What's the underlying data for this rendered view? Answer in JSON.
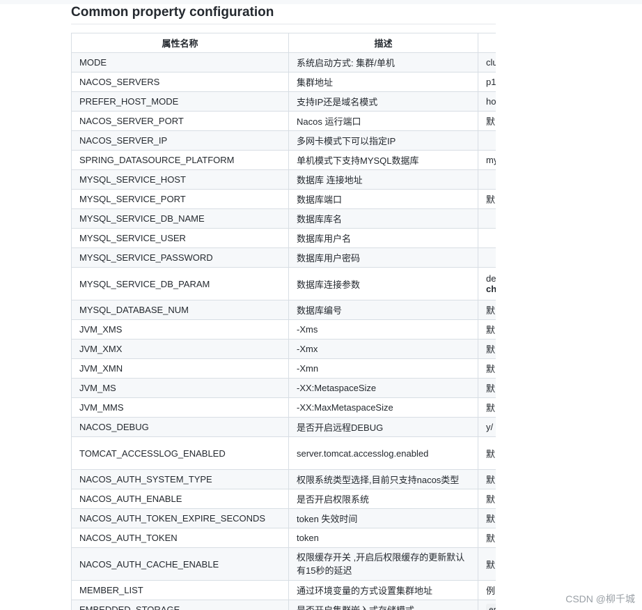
{
  "heading": "Common property configuration",
  "headers": [
    "属性名称",
    "描述",
    ""
  ],
  "rows": [
    {
      "name": "MODE",
      "desc": "系统启动方式: 集群/单机",
      "opt": "clu"
    },
    {
      "name": "NACOS_SERVERS",
      "desc": "集群地址",
      "opt": "p1"
    },
    {
      "name": "PREFER_HOST_MODE",
      "desc": "支持IP还是域名模式",
      "opt": "ho"
    },
    {
      "name": "NACOS_SERVER_PORT",
      "desc": "Nacos 运行端口",
      "opt": "默"
    },
    {
      "name": "NACOS_SERVER_IP",
      "desc": "多网卡模式下可以指定IP",
      "opt": ""
    },
    {
      "name": "SPRING_DATASOURCE_PLATFORM",
      "desc": "单机模式下支持MYSQL数据库",
      "opt": "my"
    },
    {
      "name": "MYSQL_SERVICE_HOST",
      "desc": "数据库 连接地址",
      "opt": ""
    },
    {
      "name": "MYSQL_SERVICE_PORT",
      "desc": "数据库端口",
      "opt": "默"
    },
    {
      "name": "MYSQL_SERVICE_DB_NAME",
      "desc": "数据库库名",
      "opt": ""
    },
    {
      "name": "MYSQL_SERVICE_USER",
      "desc": "数据库用户名",
      "opt": ""
    },
    {
      "name": "MYSQL_SERVICE_PASSWORD",
      "desc": "数据库用户密码",
      "opt": ""
    },
    {
      "name": "MYSQL_SERVICE_DB_PARAM",
      "desc": "数据库连接参数",
      "opt": "de",
      "opt2": "ch"
    },
    {
      "name": "MYSQL_DATABASE_NUM",
      "desc": "数据库编号",
      "opt": "默"
    },
    {
      "name": "JVM_XMS",
      "desc": "-Xms",
      "opt": "默"
    },
    {
      "name": "JVM_XMX",
      "desc": "-Xmx",
      "opt": "默"
    },
    {
      "name": "JVM_XMN",
      "desc": "-Xmn",
      "opt": "默"
    },
    {
      "name": "JVM_MS",
      "desc": "-XX:MetaspaceSize",
      "opt": "默"
    },
    {
      "name": "JVM_MMS",
      "desc": "-XX:MaxMetaspaceSize",
      "opt": "默"
    },
    {
      "name": "NACOS_DEBUG",
      "desc": "是否开启远程DEBUG",
      "opt": "y/"
    },
    {
      "name": "TOMCAT_ACCESSLOG_ENABLED",
      "desc": "server.tomcat.accesslog.enabled",
      "opt": "默"
    },
    {
      "name": "NACOS_AUTH_SYSTEM_TYPE",
      "desc": "权限系统类型选择,目前只支持nacos类型",
      "opt": "默"
    },
    {
      "name": "NACOS_AUTH_ENABLE",
      "desc": "是否开启权限系统",
      "opt": "默"
    },
    {
      "name": "NACOS_AUTH_TOKEN_EXPIRE_SECONDS",
      "desc": "token 失效时间",
      "opt": "默"
    },
    {
      "name": "NACOS_AUTH_TOKEN",
      "desc": "token",
      "opt": "默"
    },
    {
      "name": "NACOS_AUTH_CACHE_ENABLE",
      "desc": "权限缓存开关 ,开启后权限缓存的更新默认有15秒的延迟",
      "opt": "默"
    },
    {
      "name": "MEMBER_LIST",
      "desc": "通过环境变量的方式设置集群地址",
      "opt": "例"
    },
    {
      "name": "EMBEDDED_STORAGE",
      "desc": "是否开启集群嵌入式存储模式",
      "opt": "en"
    }
  ],
  "watermark": "CSDN @柳千城"
}
